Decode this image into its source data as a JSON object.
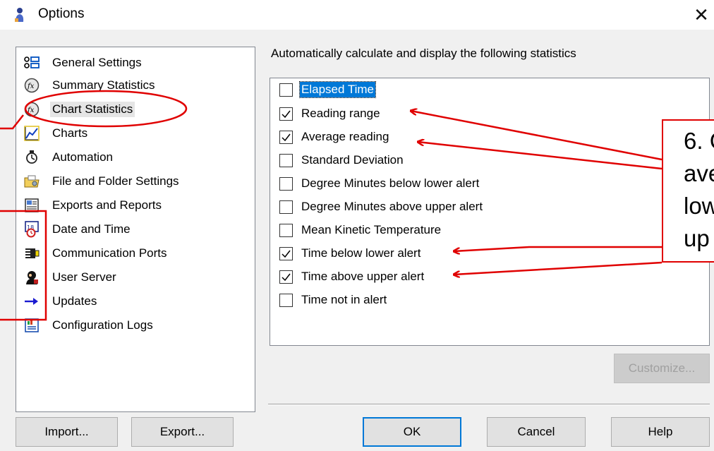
{
  "window": {
    "title": "Options",
    "close_glyph": "✕"
  },
  "sidebar": {
    "items": [
      {
        "label": "General Settings",
        "icon": "settings-list-icon"
      },
      {
        "label": "Summary Statistics",
        "icon": "fx-icon"
      },
      {
        "label": "Chart Statistics",
        "icon": "fx-icon",
        "selected": true
      },
      {
        "label": "Charts",
        "icon": "line-chart-icon"
      },
      {
        "label": "Automation",
        "icon": "automation-icon"
      },
      {
        "label": "File and Folder Settings",
        "icon": "folder-icon"
      },
      {
        "label": "Exports and Reports",
        "icon": "report-icon"
      },
      {
        "label": "Date and Time",
        "icon": "calendar-clock-icon"
      },
      {
        "label": "Communication Ports",
        "icon": "port-icon"
      },
      {
        "label": "User Server",
        "icon": "user-server-icon"
      },
      {
        "label": "Updates",
        "icon": "arrow-right-icon"
      },
      {
        "label": "Configuration Logs",
        "icon": "log-icon"
      }
    ]
  },
  "stats": {
    "heading": "Automatically calculate and display the following statistics",
    "items": [
      {
        "label": "Elapsed Time",
        "checked": false,
        "focused": true
      },
      {
        "label": "Reading range",
        "checked": true
      },
      {
        "label": "Average reading",
        "checked": true
      },
      {
        "label": "Standard Deviation",
        "checked": false
      },
      {
        "label": "Degree Minutes below lower alert",
        "checked": false
      },
      {
        "label": "Degree Minutes above upper alert",
        "checked": false
      },
      {
        "label": "Mean Kinetic Temperature",
        "checked": false
      },
      {
        "label": "Time below lower alert",
        "checked": true
      },
      {
        "label": "Time above upper alert",
        "checked": true
      },
      {
        "label": "Time not in alert",
        "checked": false
      }
    ],
    "customize_label": "Customize..."
  },
  "buttons": {
    "import": "Import...",
    "export": "Export...",
    "ok": "OK",
    "cancel": "Cancel",
    "help": "Help"
  },
  "annotation": {
    "lines": [
      "6. C",
      "ave",
      "low",
      "up"
    ],
    "color": "#e00000"
  },
  "colors": {
    "selection": "#0078d7",
    "annotation": "#e00000",
    "dialog_bg": "#f0f0f0"
  }
}
